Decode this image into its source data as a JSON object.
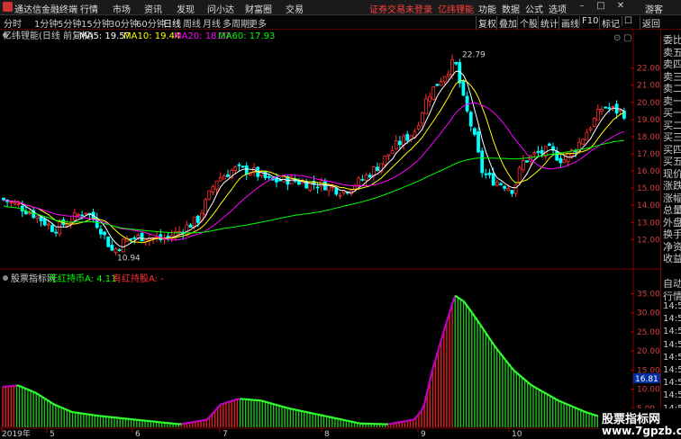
{
  "app": {
    "title": "通达信金融终端",
    "menus": [
      "行情",
      "市场",
      "资讯",
      "发现",
      "问小达",
      "财富圈",
      "交易"
    ],
    "alert": "证券交易未登录",
    "stock_short": "亿纬锂能",
    "right_menus": [
      "功能",
      "数据",
      "公式",
      "选项"
    ],
    "user": "游客"
  },
  "periods": [
    "分时",
    "1分钟",
    "5分钟",
    "15分钟",
    "30分钟",
    "60分钟",
    "日线",
    "周线",
    "月线",
    "多周期",
    "更多"
  ],
  "active_period": "日线",
  "tools": [
    "复权",
    "叠加",
    "个股",
    "统计",
    "画线",
    "F10",
    "标记",
    "☐",
    "返回"
  ],
  "main": {
    "stock_label": "亿纬锂能(日线 前复权)",
    "ma": [
      {
        "label": "MA5: 19.57",
        "color": "#ffffff"
      },
      {
        "label": "MA10: 19.44",
        "color": "#ffff00"
      },
      {
        "label": "MA20: 18.27",
        "color": "#ff00ff"
      },
      {
        "label": "MA60: 17.93",
        "color": "#00ff00"
      }
    ],
    "high_label": "22.79",
    "low_label": "10.94",
    "y_ticks": [
      "22.00",
      "21.00",
      "20.00",
      "19.00",
      "18.00",
      "17.00",
      "16.00",
      "15.00",
      "14.00",
      "13.00",
      "12.00"
    ]
  },
  "indicator": {
    "name": "股票指标网",
    "line1": "无红持币A: 4.11",
    "line2": "有红持股A: -",
    "y_ticks": [
      "35.00",
      "30.00",
      "25.00",
      "20.00",
      "15.00",
      "10.00",
      "5.00"
    ],
    "current_value": "16.81"
  },
  "x_axis": [
    "2019年",
    "5",
    "6",
    "7",
    "8",
    "9",
    "10"
  ],
  "right_panel": {
    "top_items": [
      "委比",
      "卖五",
      "卖四",
      "卖三",
      "卖二",
      "卖一",
      "买一",
      "买二",
      "买三",
      "买四",
      "买五",
      "现价",
      "涨跌",
      "涨幅",
      "总量",
      "外盘",
      "换手",
      "净资",
      "收益"
    ],
    "bottom_header": [
      "自动",
      "行情"
    ],
    "times": [
      "14:5",
      "14:5",
      "14:5",
      "14:5",
      "14:5",
      "14:5",
      "14:5",
      "14:5",
      "14:5",
      "14:5",
      "14:5"
    ]
  },
  "watermark": {
    "line1": "股票指标网",
    "line2": "www.7gpzb.com"
  },
  "chart_data": {
    "type": "line",
    "price_range": [
      10.5,
      23.5
    ],
    "indicator_range": [
      0,
      37
    ],
    "low": 10.94,
    "high": 22.79
  }
}
